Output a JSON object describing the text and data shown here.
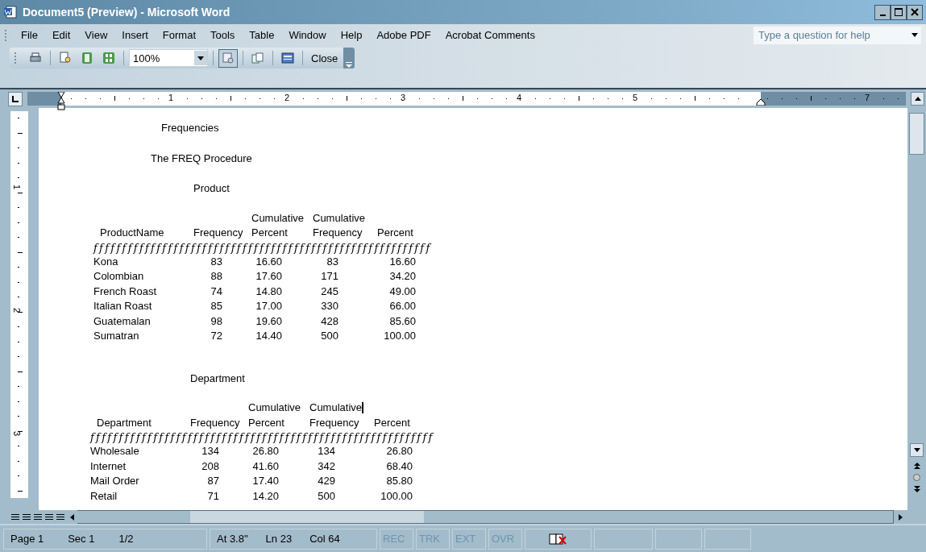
{
  "window": {
    "title": "Document5 (Preview) - Microsoft Word"
  },
  "menu": [
    {
      "label": "File"
    },
    {
      "label": "Edit"
    },
    {
      "label": "View"
    },
    {
      "label": "Insert"
    },
    {
      "label": "Format"
    },
    {
      "label": "Tools"
    },
    {
      "label": "Table"
    },
    {
      "label": "Window"
    },
    {
      "label": "Help"
    },
    {
      "label": "Adobe PDF"
    },
    {
      "label": "Acrobat Comments"
    }
  ],
  "help_box": {
    "placeholder": "Type a question for help"
  },
  "toolbar": {
    "zoom": "100%",
    "close": "Close",
    "magnifier_pressed": true
  },
  "ruler": {
    "labels": [
      "1",
      "2",
      "3",
      "4",
      "5",
      "7"
    ]
  },
  "vertical_ruler": {
    "labels": [
      "1",
      "2",
      "3"
    ]
  },
  "document": {
    "headings": [
      "Frequencies",
      "The FREQ Procedure"
    ],
    "tables": [
      {
        "title": "Product",
        "upper_header": [
          "Cumulative",
          "Cumulative"
        ],
        "columns": [
          "ProductName",
          "Frequency",
          "Percent",
          "Frequency",
          "Percent"
        ],
        "separator": "fffffffffffffffffffffffffffffffffffffffffffffffffffffffffff",
        "cursor": false,
        "rows": [
          [
            "Kona",
            "83",
            "16.60",
            "83",
            "16.60"
          ],
          [
            "Colombian",
            "88",
            "17.60",
            "171",
            "34.20"
          ],
          [
            "French Roast",
            "74",
            "14.80",
            "245",
            "49.00"
          ],
          [
            "Italian Roast",
            "85",
            "17.00",
            "330",
            "66.00"
          ],
          [
            "Guatemalan",
            "98",
            "19.60",
            "428",
            "85.60"
          ],
          [
            "Sumatran",
            "72",
            "14.40",
            "500",
            "100.00"
          ]
        ]
      },
      {
        "title": "Department",
        "upper_header": [
          "Cumulative",
          "Cumulative"
        ],
        "columns": [
          "Department",
          "Frequency",
          "Percent",
          "Frequency",
          "Percent"
        ],
        "separator": "ffffffffffffffffffffffffffffffffffffffffffffffffffffffffffff",
        "cursor": true,
        "rows": [
          [
            "Wholesale",
            "134",
            "26.80",
            "134",
            "26.80"
          ],
          [
            "Internet",
            "208",
            "41.60",
            "342",
            "68.40"
          ],
          [
            "Mail Order",
            "87",
            "17.40",
            "429",
            "85.80"
          ],
          [
            "Retail",
            "71",
            "14.20",
            "500",
            "100.00"
          ]
        ]
      }
    ]
  },
  "status_bar": {
    "fields": [
      "Page 1",
      "Sec 1",
      "1/2",
      "At 3.8\"",
      "Ln 23",
      "Col 64"
    ],
    "modes": [
      {
        "label": "REC",
        "disabled": true
      },
      {
        "label": "TRK",
        "disabled": true
      },
      {
        "label": "EXT",
        "disabled": true
      },
      {
        "label": "OVR",
        "disabled": true
      }
    ]
  }
}
